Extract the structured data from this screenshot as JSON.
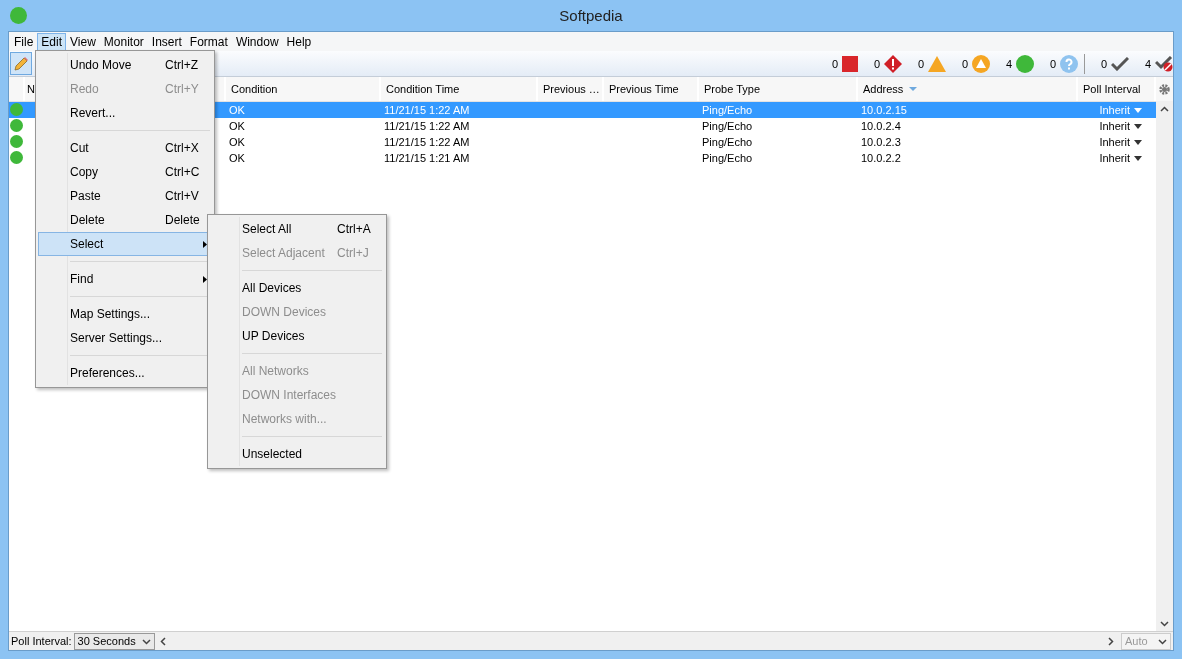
{
  "window": {
    "title": "Softpedia"
  },
  "menu_bar": [
    {
      "label": "File",
      "selected": false
    },
    {
      "label": "Edit",
      "selected": true
    },
    {
      "label": "View",
      "selected": false
    },
    {
      "label": "Monitor",
      "selected": false
    },
    {
      "label": "Insert",
      "selected": false
    },
    {
      "label": "Format",
      "selected": false
    },
    {
      "label": "Window",
      "selected": false
    },
    {
      "label": "Help",
      "selected": false
    }
  ],
  "toolbar": {
    "edit_mode": {
      "selected": true
    },
    "counters": [
      {
        "kind": "down",
        "count": "0"
      },
      {
        "kind": "critical",
        "count": "0"
      },
      {
        "kind": "warning",
        "count": "0"
      },
      {
        "kind": "alert",
        "count": "0"
      },
      {
        "kind": "up",
        "count": "4"
      },
      {
        "kind": "unknown",
        "count": "0"
      },
      {
        "kind": "acknowledged",
        "count": "0"
      },
      {
        "kind": "unacknowledged",
        "count": "4"
      }
    ]
  },
  "table": {
    "columns": [
      {},
      {
        "label": "N"
      },
      {
        "label": "Condition"
      },
      {
        "label": "Condition Time"
      },
      {
        "label": "Previous …"
      },
      {
        "label": "Previous Time"
      },
      {
        "label": "Probe Type"
      },
      {
        "label": "Address",
        "sorted": true
      },
      {
        "label": "Poll Interval"
      }
    ],
    "rows": [
      {
        "selected": true,
        "color": "#3fb83a",
        "condition": "OK",
        "condition_time": "11/21/15 1:22 AM",
        "probe_type": "Ping/Echo",
        "address": "10.0.2.15",
        "poll_interval": "Inherit"
      },
      {
        "selected": false,
        "color": "#3fb83a",
        "condition": "OK",
        "condition_time": "11/21/15 1:22 AM",
        "probe_type": "Ping/Echo",
        "address": "10.0.2.4",
        "poll_interval": "Inherit"
      },
      {
        "selected": false,
        "color": "#3fb83a",
        "condition": "OK",
        "condition_time": "11/21/15 1:22 AM",
        "probe_type": "Ping/Echo",
        "address": "10.0.2.3",
        "poll_interval": "Inherit"
      },
      {
        "selected": false,
        "color": "#3fb83a",
        "condition": "OK",
        "condition_time": "11/21/15 1:21 AM",
        "probe_type": "Ping/Echo",
        "address": "10.0.2.2",
        "poll_interval": "Inherit"
      }
    ]
  },
  "edit_menu": {
    "groups": [
      [
        {
          "label": "Undo Move",
          "shortcut": "Ctrl+Z",
          "disabled": false,
          "selected": false,
          "submenu": false
        },
        {
          "label": "Redo",
          "shortcut": "Ctrl+Y",
          "disabled": true,
          "selected": false,
          "submenu": false
        },
        {
          "label": "Revert...",
          "disabled": false,
          "selected": false,
          "submenu": false
        }
      ],
      [
        {
          "label": "Cut",
          "shortcut": "Ctrl+X",
          "disabled": false,
          "selected": false,
          "submenu": false
        },
        {
          "label": "Copy",
          "shortcut": "Ctrl+C",
          "disabled": false,
          "selected": false,
          "submenu": false
        },
        {
          "label": "Paste",
          "shortcut": "Ctrl+V",
          "disabled": false,
          "selected": false,
          "submenu": false
        },
        {
          "label": "Delete",
          "shortcut": "Delete",
          "disabled": false,
          "selected": false,
          "submenu": false
        },
        {
          "label": "Select",
          "disabled": false,
          "selected": true,
          "submenu": true
        }
      ],
      [
        {
          "label": "Find",
          "disabled": false,
          "selected": false,
          "submenu": true
        }
      ],
      [
        {
          "label": "Map Settings...",
          "disabled": false,
          "selected": false,
          "submenu": false
        },
        {
          "label": "Server Settings...",
          "disabled": false,
          "selected": false,
          "submenu": false
        }
      ],
      [
        {
          "label": "Preferences...",
          "disabled": false,
          "selected": false,
          "submenu": false
        }
      ]
    ]
  },
  "select_submenu": {
    "groups": [
      [
        {
          "label": "Select All",
          "shortcut": "Ctrl+A",
          "disabled": false,
          "selected": false,
          "submenu": false
        },
        {
          "label": "Select Adjacent",
          "shortcut": "Ctrl+J",
          "disabled": true,
          "selected": false,
          "submenu": false
        }
      ],
      [
        {
          "label": "All Devices",
          "disabled": false,
          "selected": false,
          "submenu": false
        },
        {
          "label": "DOWN Devices",
          "disabled": true,
          "selected": false,
          "submenu": false
        },
        {
          "label": "UP Devices",
          "disabled": false,
          "selected": false,
          "submenu": false
        }
      ],
      [
        {
          "label": "All Networks",
          "disabled": true,
          "selected": false,
          "submenu": false
        },
        {
          "label": "DOWN Interfaces",
          "disabled": true,
          "selected": false,
          "submenu": false
        },
        {
          "label": "Networks with...",
          "disabled": true,
          "selected": false,
          "submenu": false
        }
      ],
      [
        {
          "label": "Unselected",
          "disabled": false,
          "selected": false,
          "submenu": false
        }
      ]
    ]
  },
  "status_bar": {
    "label": "Poll Interval:",
    "poll_interval": "30 Seconds",
    "zoom": {
      "value": "Auto",
      "disabled": true
    }
  }
}
